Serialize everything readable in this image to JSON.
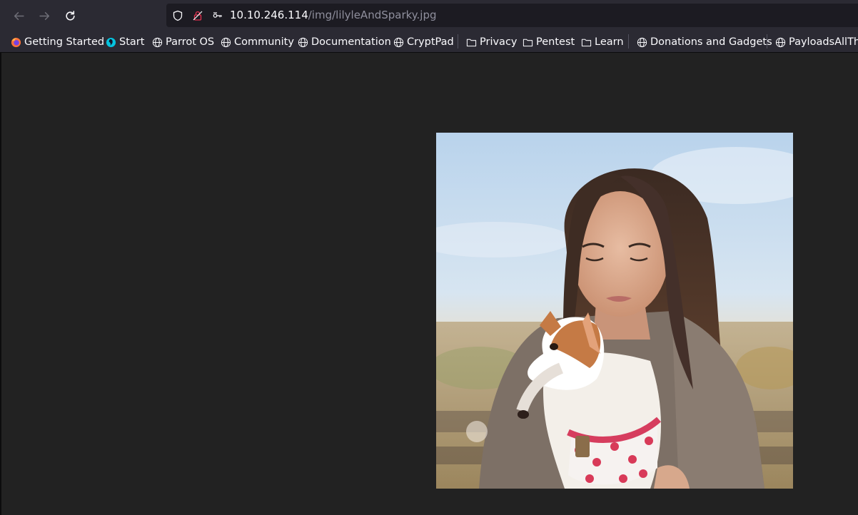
{
  "browser": {
    "url_host": "10.10.246.114",
    "url_path": "/img/lilyleAndSparky.jpg",
    "back_icon": "arrow-left-icon",
    "forward_icon": "arrow-right-icon",
    "reload_icon": "reload-icon"
  },
  "bookmarks": [
    {
      "label": "Getting Started",
      "icon": "firefox-icon"
    },
    {
      "label": "Start",
      "icon": "parrot-icon"
    },
    {
      "label": "Parrot OS",
      "icon": "globe-icon"
    },
    {
      "label": "Community",
      "icon": "globe-icon"
    },
    {
      "label": "Documentation",
      "icon": "globe-icon"
    },
    {
      "label": "CryptPad",
      "icon": "globe-icon"
    },
    {
      "label": "Privacy",
      "icon": "folder-icon"
    },
    {
      "label": "Pentest",
      "icon": "folder-icon"
    },
    {
      "label": "Learn",
      "icon": "folder-icon"
    },
    {
      "label": "Donations and Gadgets",
      "icon": "globe-icon"
    },
    {
      "label": "PayloadsAllThe",
      "icon": "globe-icon"
    }
  ],
  "colors": {
    "toolbar": "#2b2a33",
    "urlbar": "#1c1b22",
    "page_background": "#222222",
    "permission_accent": "#e3304f"
  }
}
